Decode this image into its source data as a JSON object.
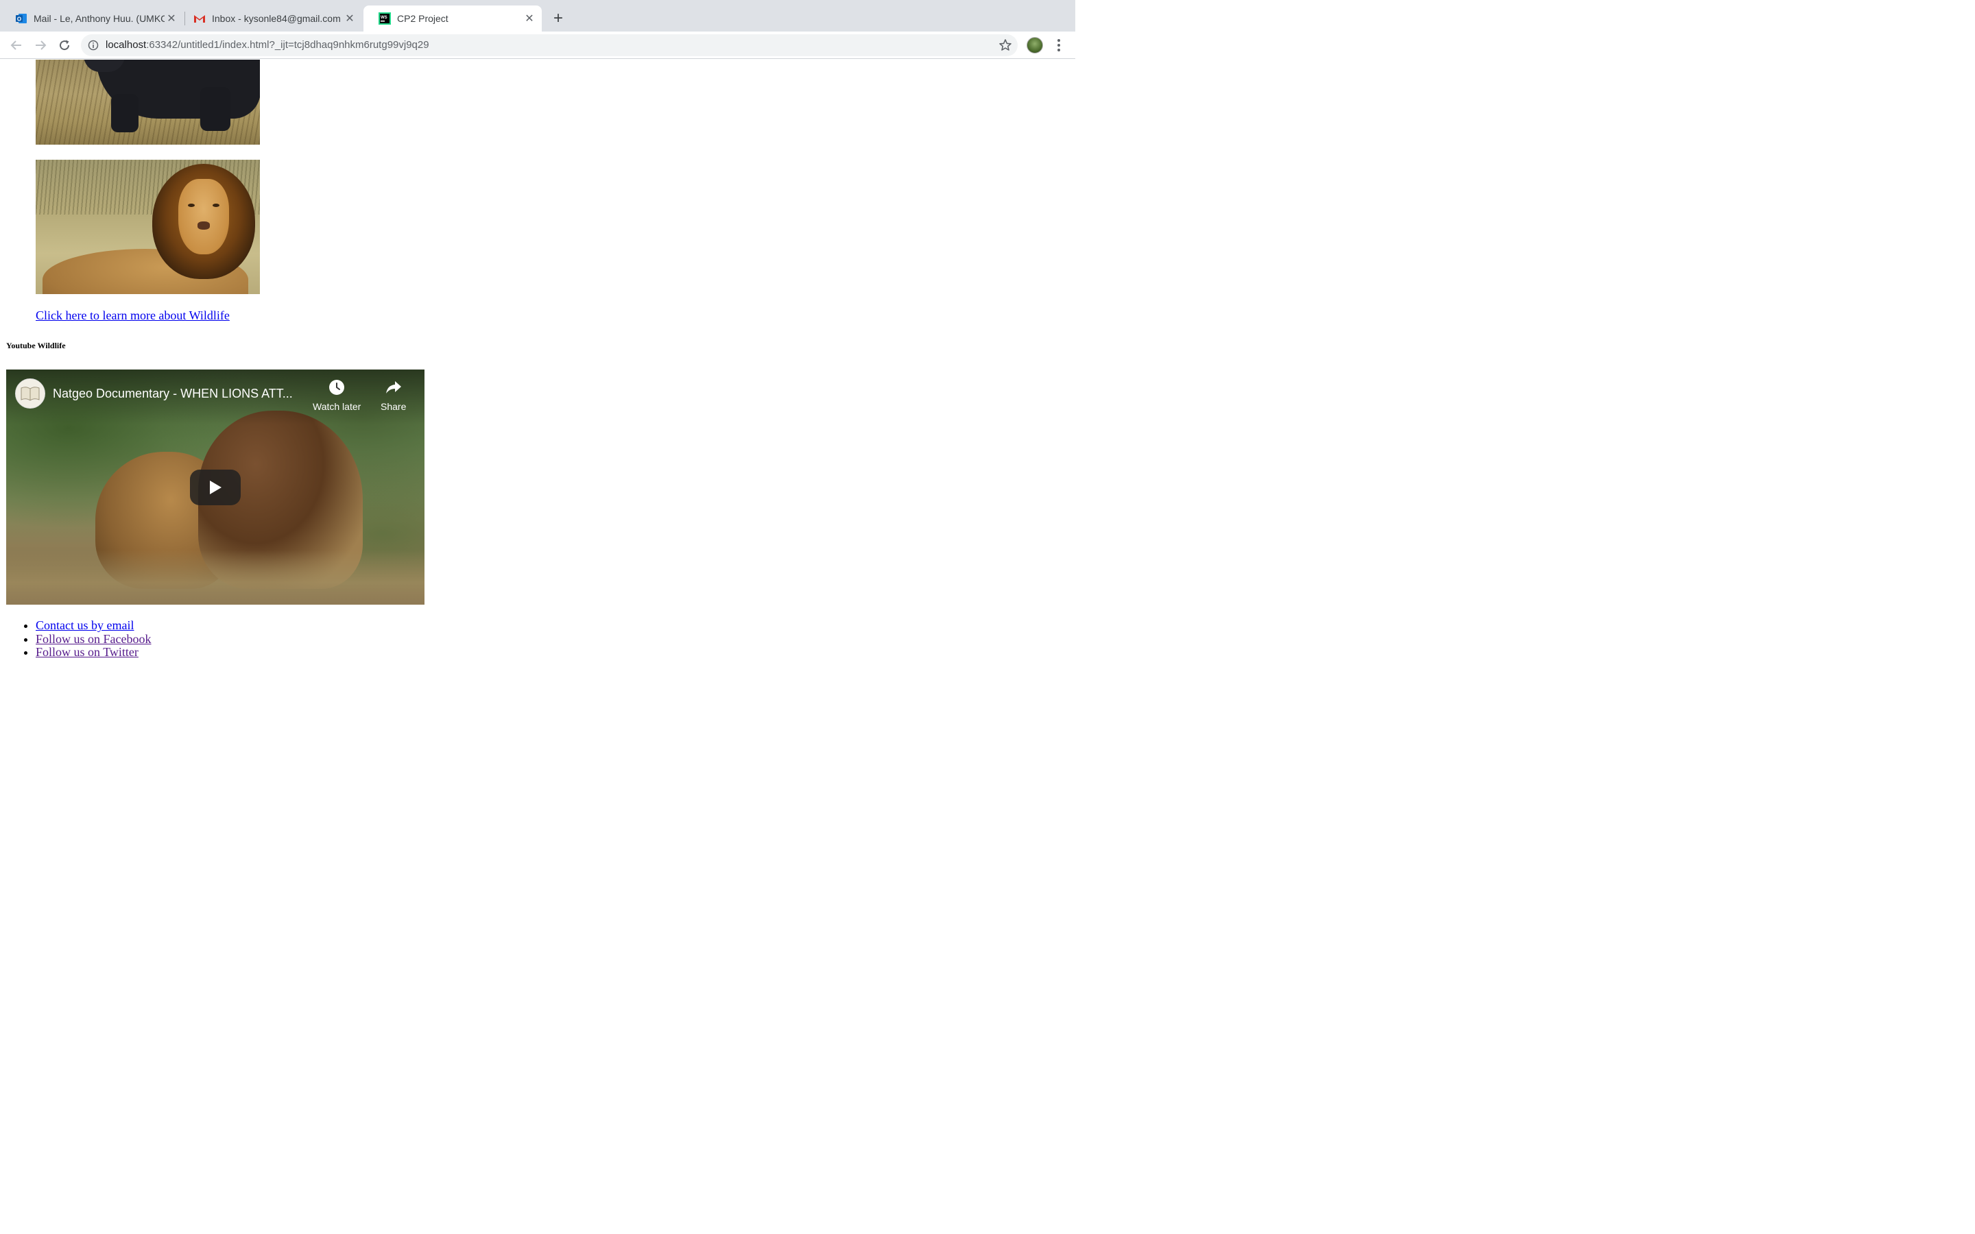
{
  "browser": {
    "tabs": [
      {
        "title": "Mail - Le, Anthony Huu. (UMKC",
        "icon": "outlook-icon",
        "active": false
      },
      {
        "title": "Inbox - kysonle84@gmail.com",
        "icon": "gmail-icon",
        "active": false
      },
      {
        "title": "CP2 Project",
        "icon": "webstorm-icon",
        "active": true
      }
    ],
    "new_tab_label": "+",
    "close_glyph": "✕",
    "url_host": "localhost",
    "url_rest": ":63342/untitled1/index.html?_ijt=tcj8dhaq9nhkm6rutg99vj9q29"
  },
  "page": {
    "images": [
      {
        "name": "bear-image",
        "alt": "bear"
      },
      {
        "name": "lion-image",
        "alt": "lion"
      }
    ],
    "learn_link": "Click here to learn more about Wildlife",
    "youtube_heading": "Youtube Wildlife",
    "video": {
      "title": "Natgeo Documentary - WHEN LIONS ATT...",
      "watch_later": "Watch later",
      "share": "Share"
    },
    "footer_links": [
      {
        "label": "Contact us by email",
        "visited": false
      },
      {
        "label": "Follow us on Facebook",
        "visited": true
      },
      {
        "label": "Follow us on Twitter",
        "visited": true
      }
    ]
  },
  "colors": {
    "link": "#0000ee",
    "visited_link": "#551a8b",
    "tabstrip": "#dee1e6",
    "omnibox": "#f1f3f4"
  }
}
